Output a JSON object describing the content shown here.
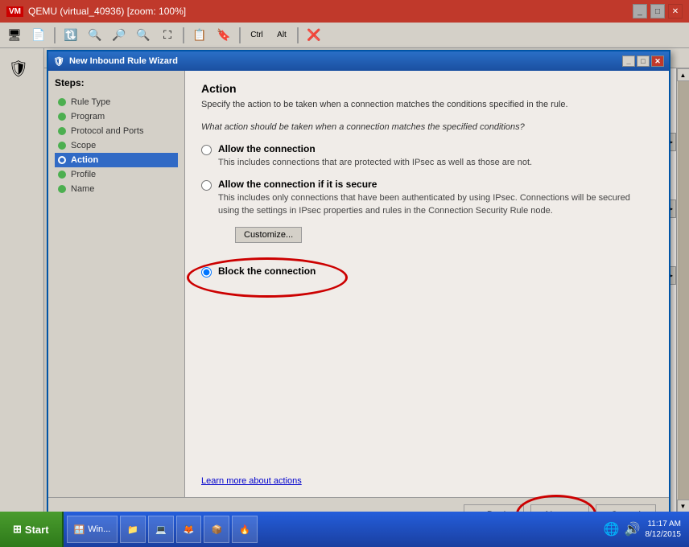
{
  "window": {
    "title": "QEMU (virtual_40936) [zoom: 100%]",
    "title_icon": "🖥"
  },
  "toolbar_buttons": [
    "🔄",
    "📄",
    "🔃",
    "🔍",
    "🔍",
    "🔍",
    "🔲",
    "🔲",
    "📋",
    "🔖",
    "Ctrl",
    "Alt",
    "❌"
  ],
  "wizard": {
    "title": "New Inbound Rule Wizard",
    "section": {
      "heading": "Action",
      "subtitle": "Specify the action to be taken when a connection matches the conditions specified in the rule.",
      "question": "What action should be taken when a connection matches the specified conditions?"
    },
    "steps_label": "Steps:",
    "steps": [
      {
        "label": "Rule Type",
        "status": "done"
      },
      {
        "label": "Program",
        "status": "done"
      },
      {
        "label": "Protocol and Ports",
        "status": "done"
      },
      {
        "label": "Scope",
        "status": "done"
      },
      {
        "label": "Action",
        "status": "active"
      },
      {
        "label": "Profile",
        "status": "pending"
      },
      {
        "label": "Name",
        "status": "pending"
      }
    ],
    "options": [
      {
        "id": "allow",
        "label": "Allow the connection",
        "description": "This includes connections that are protected with IPsec as well as those are not.",
        "selected": false
      },
      {
        "id": "allow_secure",
        "label": "Allow the connection if it is secure",
        "description": "This includes only connections that have been authenticated by using IPsec.  Connections will be secured using the settings in IPsec properties and rules in the Connection Security Rule node.",
        "selected": false
      },
      {
        "id": "block",
        "label": "Block the connection",
        "description": "",
        "selected": true
      }
    ],
    "customize_label": "Customize...",
    "learn_more": "Learn more about actions",
    "footer": {
      "back": "< Back",
      "next": "Next >",
      "cancel": "Cancel"
    }
  },
  "taskbar": {
    "start_label": "Start",
    "items": [
      "🪟 Win...",
      "📁",
      "💻",
      "🔥",
      "📦",
      "🔥"
    ],
    "time": "11:17 AM",
    "date": "8/12/2015"
  }
}
